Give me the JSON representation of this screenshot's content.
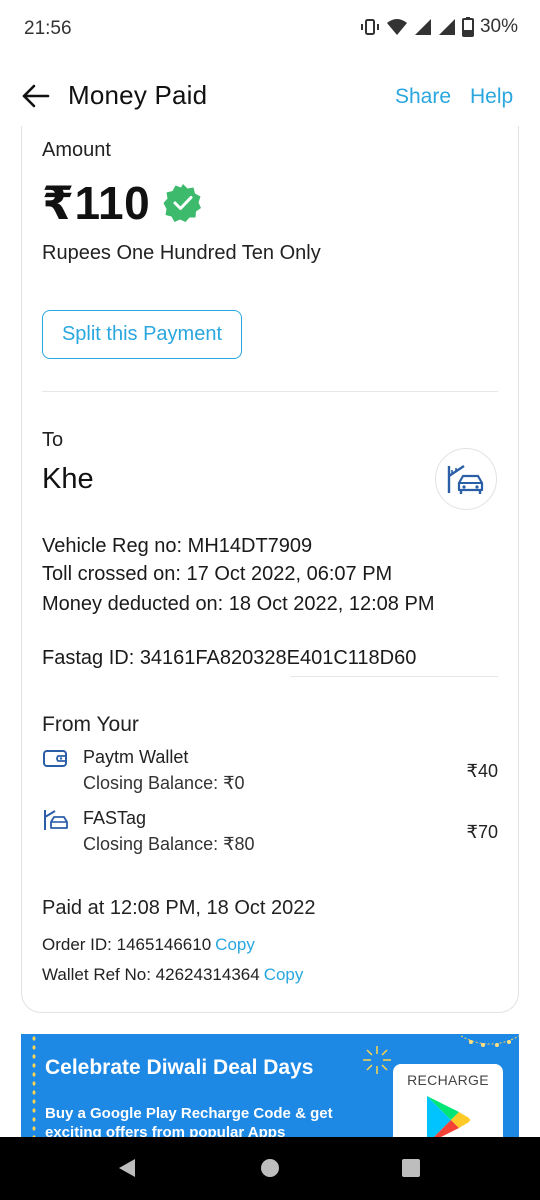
{
  "status_bar": {
    "time": "21:56",
    "battery": "30%"
  },
  "header": {
    "title": "Money Paid",
    "share_label": "Share",
    "help_label": "Help"
  },
  "payment": {
    "amount_label": "Amount",
    "amount": "₹110",
    "amount_words": "Rupees One Hundred Ten Only",
    "split_label": "Split this Payment"
  },
  "payee": {
    "to_label": "To",
    "name": "Khe",
    "vehicle_reg": "Vehicle Reg no: MH14DT7909",
    "toll_crossed": "Toll crossed on: 17 Oct 2022, 06:07 PM",
    "money_deducted": "Money deducted on: 18 Oct 2022, 12:08 PM",
    "fastag_id": "Fastag ID: 34161FA820328E401C118D60"
  },
  "sources": {
    "from_label": "From Your",
    "items": [
      {
        "name": "Paytm Wallet",
        "closing_balance": "Closing Balance: ₹0",
        "amount": "₹40",
        "icon": "wallet-icon"
      },
      {
        "name": "FASTag",
        "closing_balance": "Closing Balance: ₹80",
        "amount": "₹70",
        "icon": "fastag-icon"
      }
    ]
  },
  "transaction": {
    "paid_at": "Paid at 12:08 PM, 18 Oct 2022",
    "order_id": "Order ID: 1465146610",
    "wallet_ref": "Wallet Ref No: 42624314364",
    "copy_label": "Copy"
  },
  "banner": {
    "title": "Celebrate Diwali Deal Days",
    "subtitle": "Buy a Google Play Recharge Code & get exciting offers from popular Apps",
    "recharge_label": "RECHARGE"
  },
  "colors": {
    "accent": "#2aa7df",
    "verified": "#3dba6b",
    "banner": "#1e88e5"
  }
}
